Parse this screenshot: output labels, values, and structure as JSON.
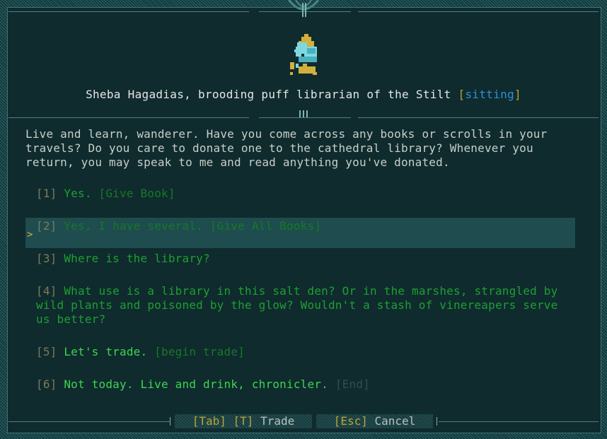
{
  "npc": {
    "name": "Sheba Hagadias, brooding puff librarian of the Stilt",
    "status": "sitting"
  },
  "dialogue": {
    "text": "Live and learn, wanderer. Have you come across any books or scrolls in your travels? Do you care to donate one to the cathedral library? Whenever you return, you may speak to me and read anything you've donated."
  },
  "choices": [
    {
      "num": "[1]",
      "text": "Yes.",
      "tag": "[Give Book]"
    },
    {
      "num": "[2]",
      "text": "Yes, I have several.",
      "tag": "[Give All Books]"
    },
    {
      "num": "[3]",
      "text": "Where is the library?",
      "tag": ""
    },
    {
      "num": "[4]",
      "text": "What use is a library in this salt den? Or in the marshes, strangled by wild plants and poisoned by the glow? Wouldn't a stash of vinereapers serve us better?",
      "tag": ""
    },
    {
      "num": "[5]",
      "text": "Let's trade.",
      "tag": "[begin trade]"
    },
    {
      "num": "[6]",
      "text": "Not today. Live and drink, chronicler.",
      "tag": "[End]"
    }
  ],
  "selected_choice": 2,
  "cursor_glyph": ">",
  "footer": {
    "trade_keys": "[Tab] [T]",
    "trade_label": "Trade",
    "cancel_key": "[Esc]",
    "cancel_label": "Cancel"
  },
  "colors": {
    "background": "#0f2b2e",
    "choice_text": "#1f9f31",
    "key_hint": "#b9a339",
    "status": "#2e90d8"
  }
}
